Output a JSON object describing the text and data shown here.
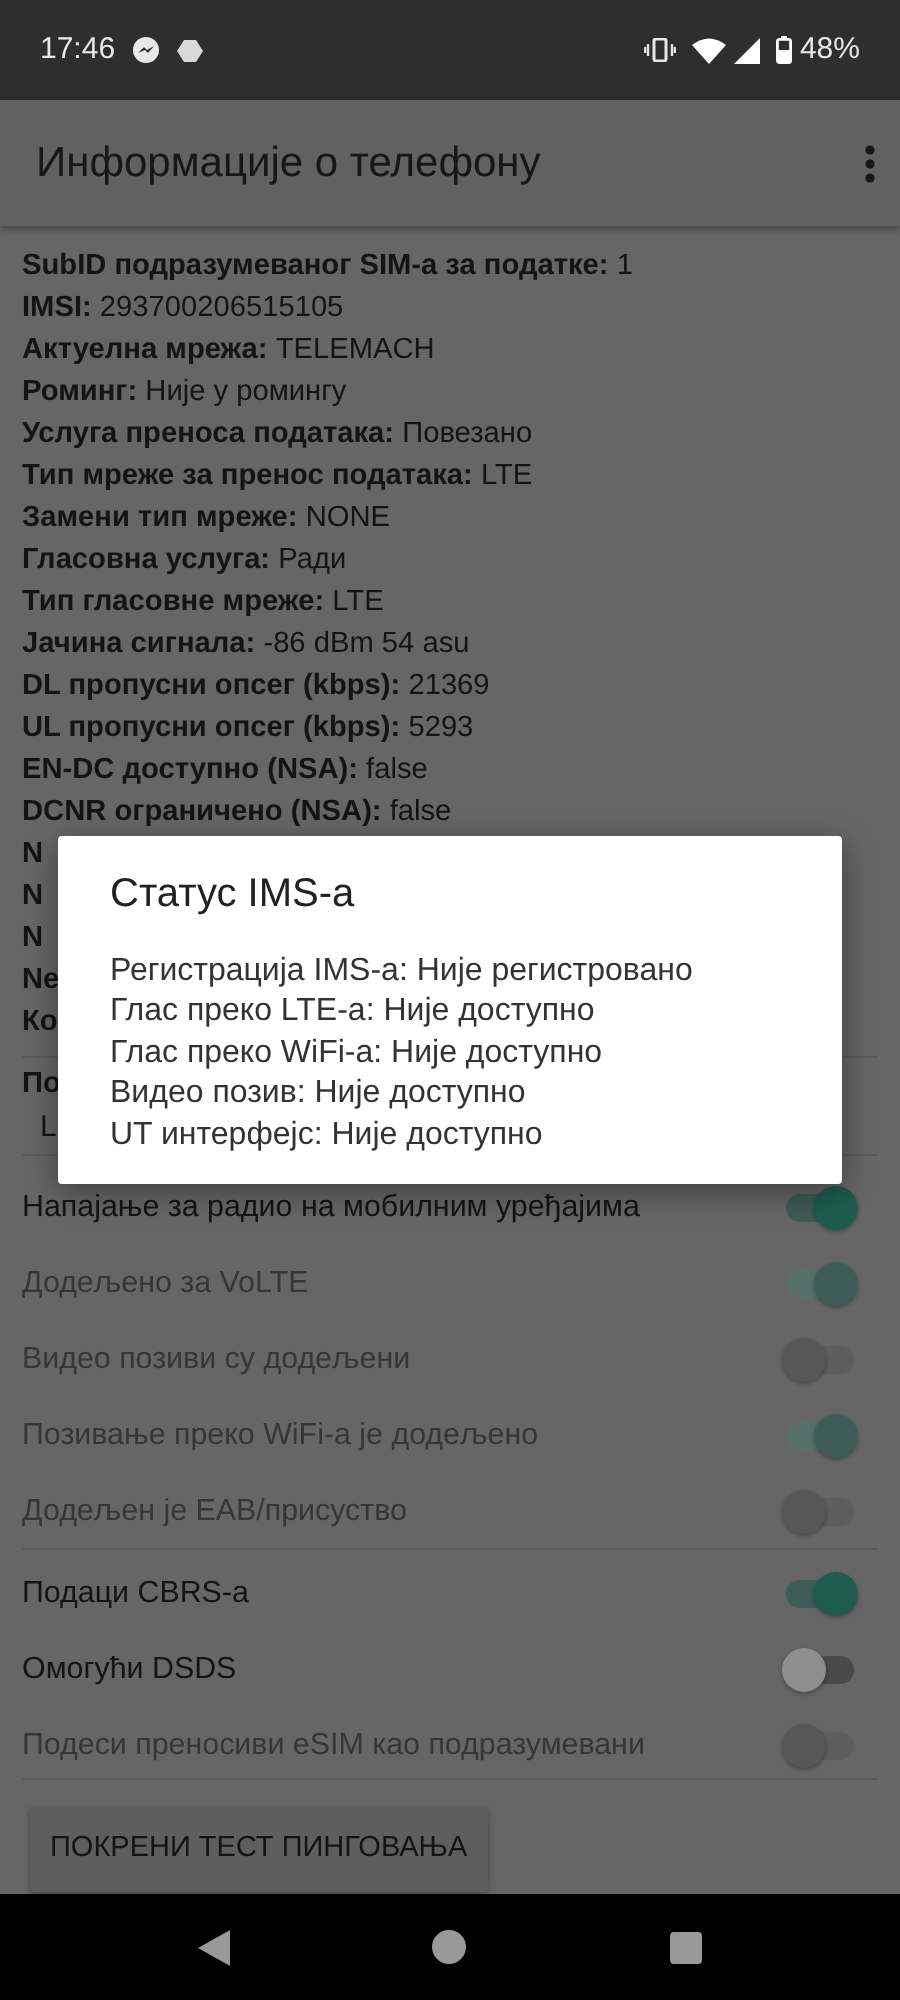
{
  "status_bar": {
    "time": "17:46",
    "battery": "48%"
  },
  "app_bar": {
    "title": "Информације о телефону"
  },
  "info_rows": [
    {
      "label": "SubID подразумеваног SIM-а за податке:",
      "value": "1"
    },
    {
      "label": "IMSI:",
      "value": "293700206515105"
    },
    {
      "label": "Актуелна мрежа:",
      "value": "TELEMACH"
    },
    {
      "label": "Роминг:",
      "value": "Није у ромингу"
    },
    {
      "label": "Услуга преноса података:",
      "value": "Повезано"
    },
    {
      "label": "Тип мреже за пренос података:",
      "value": "LTE"
    },
    {
      "label": "Замени тип мреже:",
      "value": "NONE"
    },
    {
      "label": "Гласовна услуга:",
      "value": "Ради"
    },
    {
      "label": "Тип гласовне мреже:",
      "value": "LTE"
    },
    {
      "label": "Јачина сигнала:",
      "value": "-86 dBm   54 asu"
    },
    {
      "label": "DL пропусни опсег (kbps):",
      "value": "21369"
    },
    {
      "label": "UL пропусни опсег (kbps):",
      "value": "5293"
    },
    {
      "label": "EN-DC доступно (NSA):",
      "value": "false"
    },
    {
      "label": "DCNR ограничено (NSA):",
      "value": "false"
    },
    {
      "label": "N"
    },
    {
      "label": "N"
    },
    {
      "label": "N"
    },
    {
      "label": "Ne"
    },
    {
      "label": "Ко"
    }
  ],
  "network_type": {
    "label": "По",
    "value": "L"
  },
  "switches": [
    {
      "label": "Напајање за радио на мобилним уређајима",
      "on": true,
      "disabled": false
    },
    {
      "label": "Додељено за VoLTE",
      "on": true,
      "disabled": true
    },
    {
      "label": "Видео позиви су додељени",
      "on": false,
      "disabled": true
    },
    {
      "label": "Позивање преко WiFi-а је додељено",
      "on": true,
      "disabled": true
    },
    {
      "label": "Додељен је EAB/присуство",
      "on": false,
      "disabled": true,
      "divider_after": true
    },
    {
      "label": "Подаци CBRS-а",
      "on": true,
      "disabled": false
    },
    {
      "label": "Омогући DSDS",
      "on": false,
      "disabled": false
    },
    {
      "label": "Подеси преносиви eSIM као подразумевани",
      "on": false,
      "disabled": true
    }
  ],
  "ping_button": "ПОКРЕНИ ТЕСТ ПИНГОВАЊА",
  "dialog": {
    "title": "Статус IMS-а",
    "lines": [
      "Регистрација IMS-а: Није регистровано",
      "Глас преко LTE-а: Није доступно",
      "Глас преко WiFi-а: Није доступно",
      "Видео позив: Није доступно",
      "UT интерфејс: Није доступно"
    ]
  }
}
